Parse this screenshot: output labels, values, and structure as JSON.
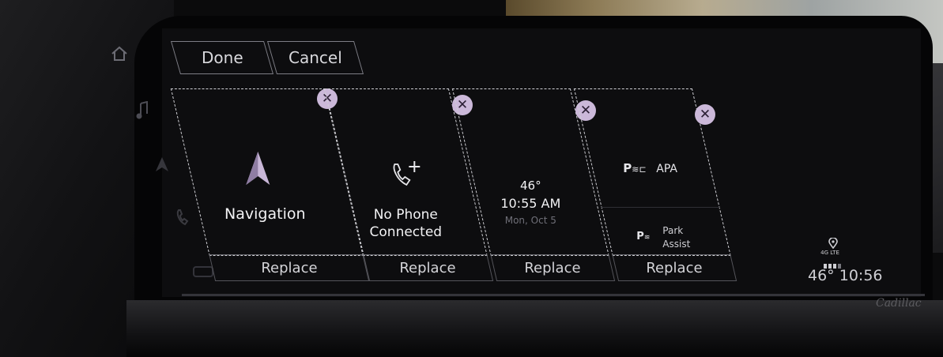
{
  "header": {
    "done_label": "Done",
    "cancel_label": "Cancel"
  },
  "tiles": [
    {
      "title": "Navigation",
      "icon": "navigation-arrow-icon",
      "replace_label": "Replace"
    },
    {
      "line1": "No Phone",
      "line2": "Connected",
      "icon": "phone-add-icon",
      "replace_label": "Replace"
    },
    {
      "temp": "46°",
      "time": "10:55 AM",
      "date": "Mon, Oct 5",
      "replace_label": "Replace"
    },
    {
      "apa_label": "APA",
      "park_assist_label": "Park Assist",
      "icon": "parking-sensor-icon",
      "replace_label": "Replace"
    }
  ],
  "status": {
    "network": "4G LTE",
    "temp": "46°",
    "time": "10:56"
  },
  "brand": "Cadillac",
  "colors": {
    "accent": "#cbb8d9",
    "dashed_border": "#cfcfd4",
    "screen_bg": "#0d0d0f"
  }
}
